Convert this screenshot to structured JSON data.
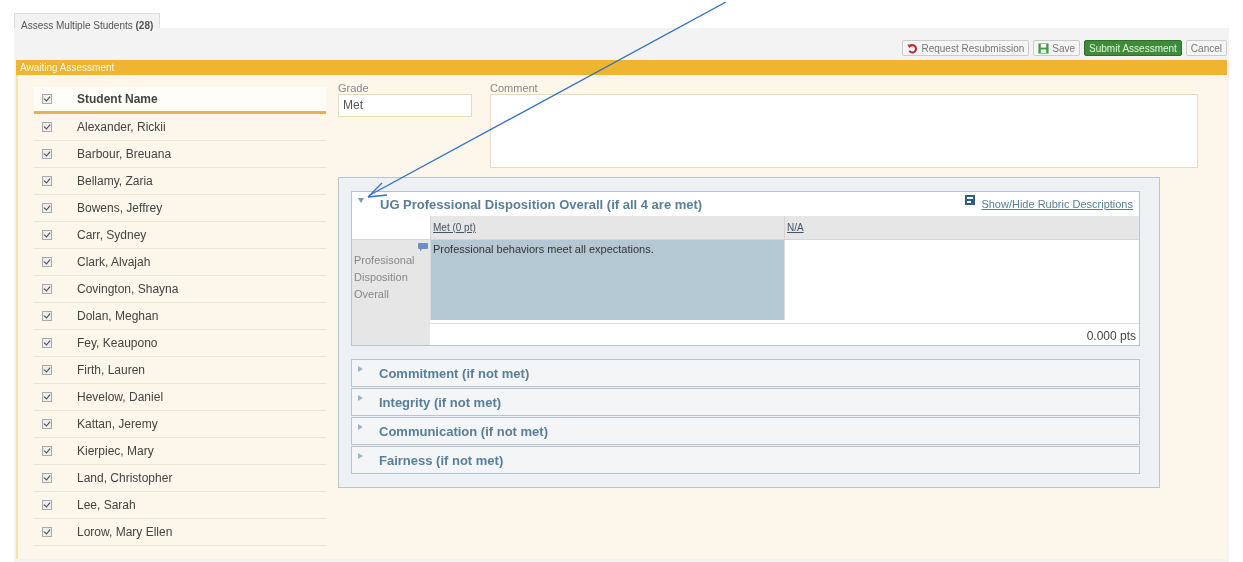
{
  "tabs": [
    {
      "label": "Assess Multiple Students **(28)**",
      "selected": true
    }
  ],
  "toolbar": [
    {
      "kind": "resubmit",
      "label": "Request Resubmission"
    },
    {
      "kind": "save",
      "label": "Save"
    },
    {
      "kind": "submit",
      "label": "Submit Assessment"
    },
    {
      "kind": "cancel",
      "label": "Cancel"
    }
  ],
  "panel_title": "Awaiting Assessment",
  "students": {
    "header": {
      "label": "Student Name",
      "checked": true
    },
    "rows": [
      {
        "name": "Alexander, Rickii",
        "checked": true
      },
      {
        "name": "Barbour, Breuana",
        "checked": true
      },
      {
        "name": "Bellamy, Zaria",
        "checked": true
      },
      {
        "name": "Bowens, Jeffrey",
        "checked": true
      },
      {
        "name": "Carr, Sydney",
        "checked": true
      },
      {
        "name": "Clark, Alvajah",
        "checked": true
      },
      {
        "name": "Covington, Shayna",
        "checked": true
      },
      {
        "name": "Dolan, Meghan",
        "checked": true
      },
      {
        "name": "Fey, Keaupono",
        "checked": true
      },
      {
        "name": "Firth, Lauren",
        "checked": true
      },
      {
        "name": "Hevelow, Daniel",
        "checked": true
      },
      {
        "name": "Kattan, Jeremy",
        "checked": true
      },
      {
        "name": "Kierpiec, Mary",
        "checked": true
      },
      {
        "name": "Land, Christopher",
        "checked": true
      },
      {
        "name": "Lee, Sarah",
        "checked": true
      },
      {
        "name": "Lorow, Mary Ellen",
        "checked": true
      }
    ]
  },
  "grade": {
    "label": "Grade",
    "value": "Met"
  },
  "comment": {
    "label": "Comment"
  },
  "rubric": {
    "toggle_link": "Show/Hide Rubric Descriptions",
    "criteria": [
      {
        "title": "UG Professional Disposition Overall (if all 4 are met)",
        "expanded": true,
        "columns": [
          "Met (0 pt)",
          "N/A"
        ],
        "row_label": "Profesisonal Disposition Overall",
        "cells": [
          {
            "text": "Professional behaviors meet all expectations.",
            "selected": true
          },
          {
            "text": "",
            "selected": false
          }
        ],
        "points": "0.000 pts"
      },
      {
        "title": "Commitment (if not met)",
        "expanded": false
      },
      {
        "title": "Integrity (if not met)",
        "expanded": false
      },
      {
        "title": "Communication (if not met)",
        "expanded": false
      },
      {
        "title": "Fairness (if not met)",
        "expanded": false
      }
    ]
  }
}
